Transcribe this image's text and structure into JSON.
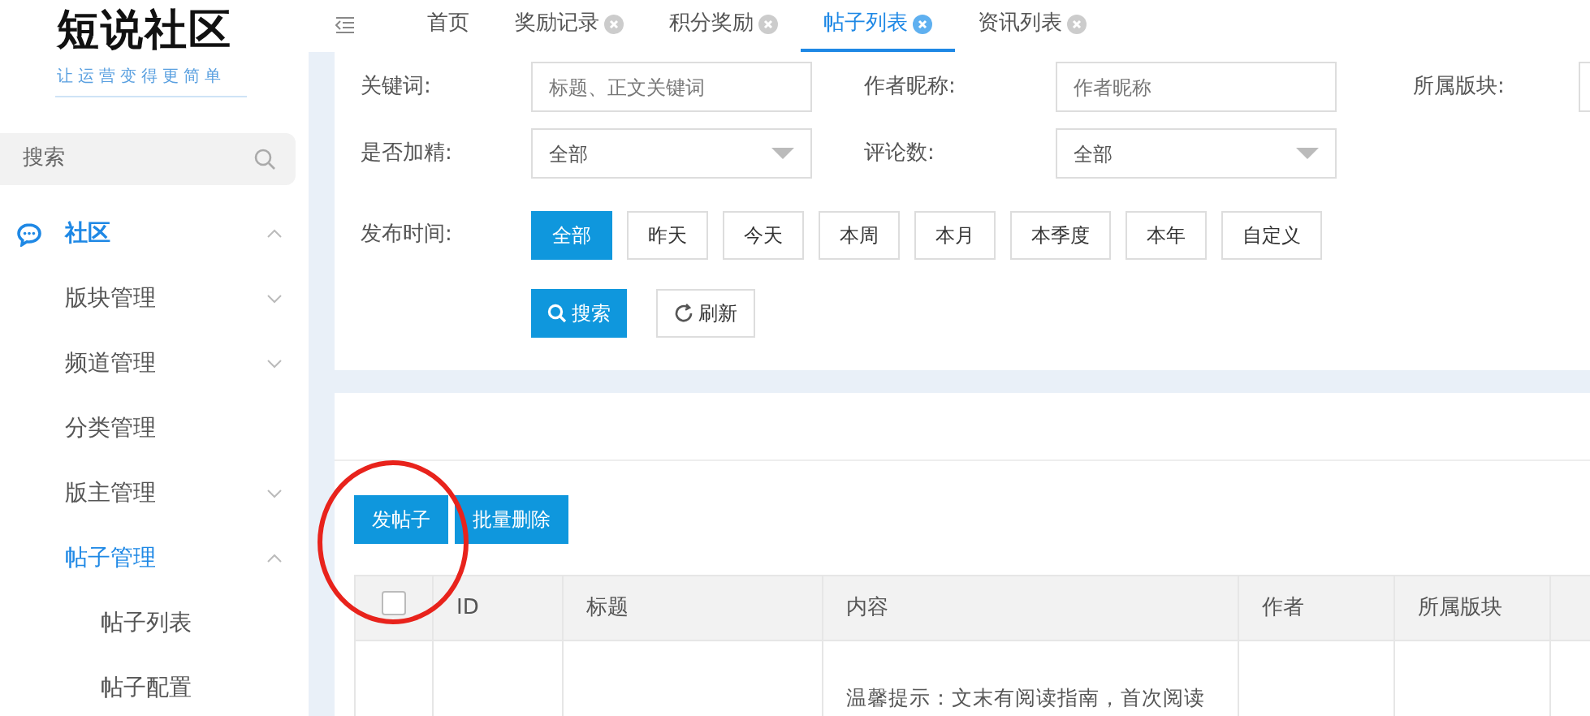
{
  "sidebar": {
    "logo": "短说社区",
    "slogan": "让运营变得更简单",
    "search": {
      "placeholder": "搜索"
    },
    "items": [
      {
        "label": "社区",
        "kind": "group",
        "expanded": true,
        "selected": true,
        "children": [
          {
            "label": "版块管理",
            "expanded": false,
            "selected": false
          },
          {
            "label": "频道管理",
            "expanded": false,
            "selected": false
          },
          {
            "label": "分类管理",
            "selected": false
          },
          {
            "label": "版主管理",
            "expanded": false,
            "selected": false
          },
          {
            "label": "帖子管理",
            "expanded": true,
            "selected": true,
            "children": [
              {
                "label": "帖子列表",
                "selected": false
              },
              {
                "label": "帖子配置",
                "selected": false
              }
            ]
          }
        ]
      }
    ]
  },
  "tabs": [
    {
      "label": "首页",
      "closable": false,
      "selected": false
    },
    {
      "label": "奖励记录",
      "closable": true,
      "selected": false
    },
    {
      "label": "积分奖励",
      "closable": true,
      "selected": false
    },
    {
      "label": "帖子列表",
      "closable": true,
      "selected": true
    },
    {
      "label": "资讯列表",
      "closable": true,
      "selected": false
    }
  ],
  "filters": {
    "rows": [
      [
        {
          "label": "关键词:",
          "kind": "input",
          "placeholder": "标题、正文关键词"
        },
        {
          "label": "作者昵称:",
          "kind": "input",
          "placeholder": "作者昵称"
        },
        {
          "label": "所属版块:",
          "kind": "input"
        }
      ],
      [
        {
          "label": "是否加精:",
          "kind": "select",
          "value": "全部"
        },
        {
          "label": "评论数:",
          "kind": "select",
          "value": "全部"
        }
      ]
    ],
    "time_label": "发布时间:",
    "time_options": [
      {
        "label": "全部",
        "selected": true
      },
      {
        "label": "昨天",
        "selected": false
      },
      {
        "label": "今天",
        "selected": false
      },
      {
        "label": "本周",
        "selected": false
      },
      {
        "label": "本月",
        "selected": false
      },
      {
        "label": "本季度",
        "selected": false
      },
      {
        "label": "本年",
        "selected": false
      },
      {
        "label": "自定义",
        "selected": false
      }
    ],
    "search_button": "搜索",
    "refresh_button": "刷新"
  },
  "buttons": [
    {
      "label": "发帖子",
      "circled": true
    },
    {
      "label": "批量删除",
      "circled": false
    }
  ],
  "table": {
    "select_all_checked": false,
    "columns": [
      "ID",
      "标题",
      "内容",
      "作者",
      "所属版块"
    ],
    "rows": [
      {
        "cells": [
          "",
          "",
          "温馨提示：文末有阅读指南，首次阅读",
          "",
          ""
        ]
      }
    ]
  }
}
